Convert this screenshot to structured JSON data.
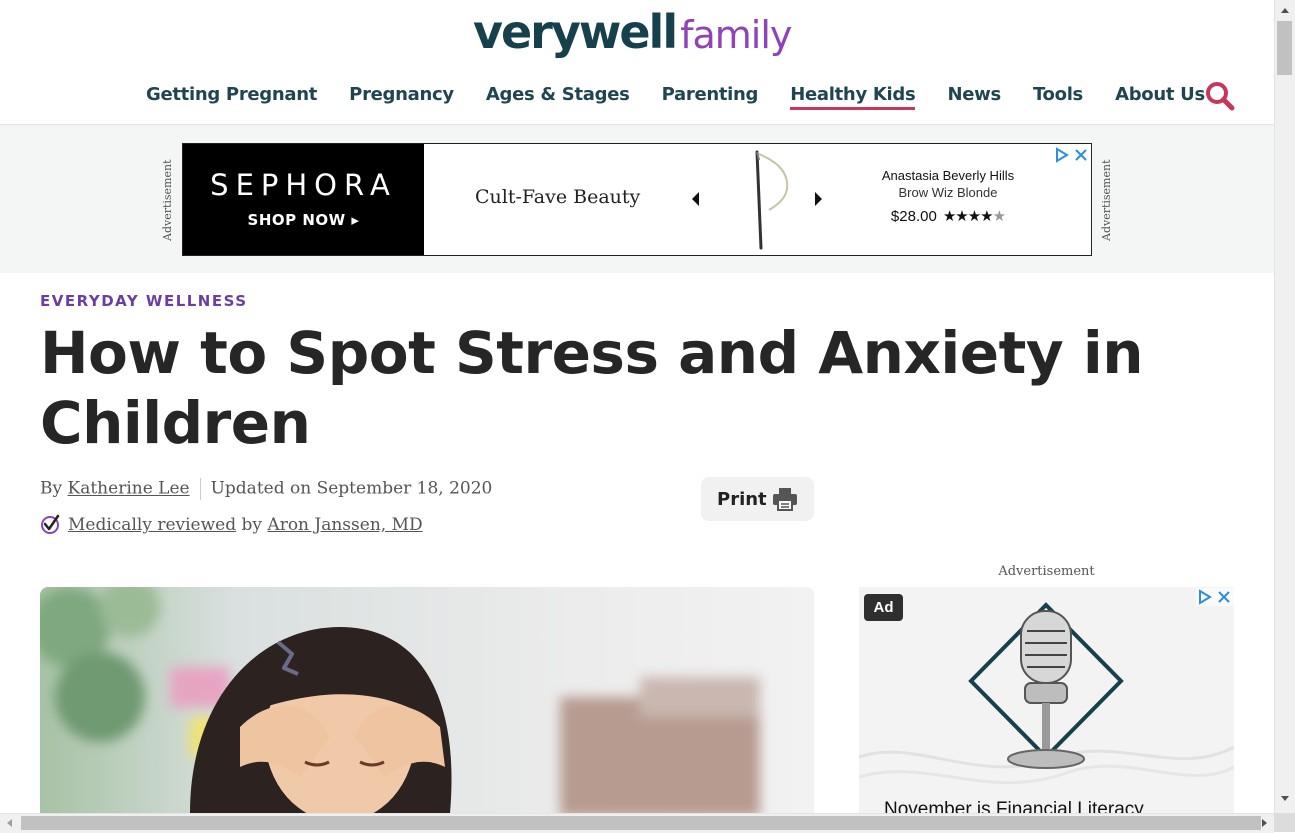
{
  "header": {
    "logo_main": "verywell",
    "logo_sub": "family",
    "nav": [
      {
        "label": "Getting Pregnant",
        "active": false
      },
      {
        "label": "Pregnancy",
        "active": false
      },
      {
        "label": "Ages & Stages",
        "active": false
      },
      {
        "label": "Parenting",
        "active": false
      },
      {
        "label": "Healthy Kids",
        "active": true
      },
      {
        "label": "News",
        "active": false
      },
      {
        "label": "Tools",
        "active": false
      },
      {
        "label": "About Us",
        "active": false
      }
    ],
    "search_icon": "search-icon"
  },
  "top_ad": {
    "side_label": "Advertisement",
    "brand": "SEPHORA",
    "cta": "SHOP NOW ▸",
    "tagline": "Cult-Fave Beauty",
    "product_brand": "Anastasia Beverly Hills",
    "product_name": "Brow Wiz Blonde",
    "price": "$28.00",
    "rating": 4
  },
  "article": {
    "kicker": "EVERYDAY WELLNESS",
    "title": "How to Spot Stress and Anxiety in Children",
    "by_prefix": "By",
    "author": "Katherine Lee",
    "updated": "Updated on September 18, 2020",
    "reviewed_link": "Medically reviewed",
    "reviewed_by_word": "by",
    "reviewer": "Aron Janssen, MD",
    "print_label": "Print"
  },
  "side_ad": {
    "label": "Advertisement",
    "badge": "Ad",
    "headline": "November is Financial Literacy"
  },
  "colors": {
    "brand_dark": "#16414c",
    "brand_purple": "#8e44b8",
    "kicker": "#6b3fa0",
    "nav_active_underline": "#c8375a",
    "search": "#c8375a"
  }
}
